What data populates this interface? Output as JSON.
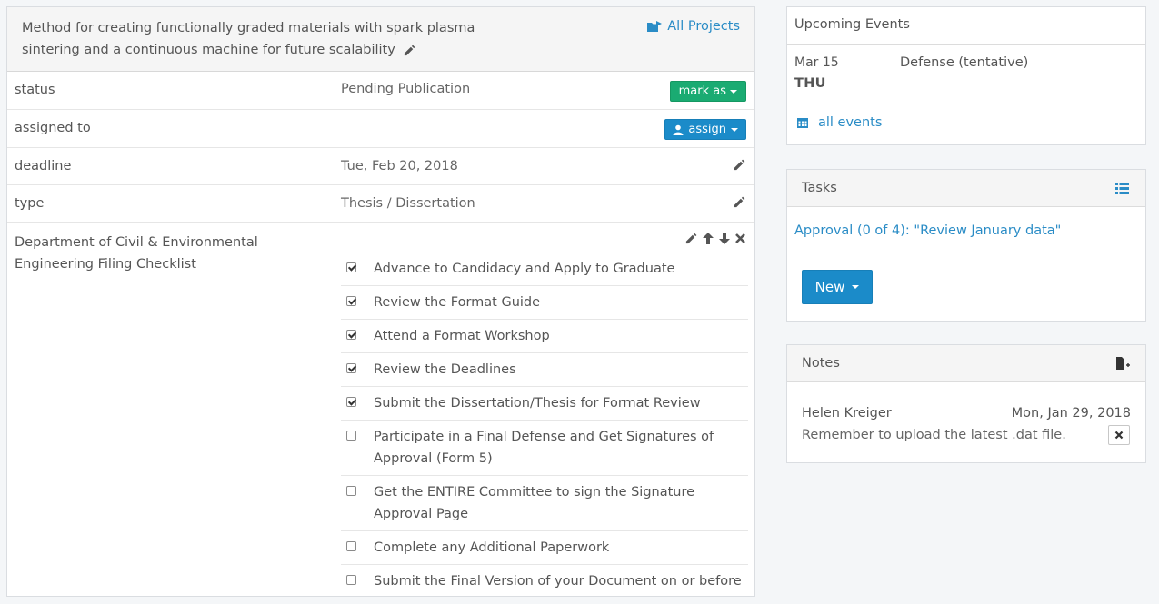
{
  "project": {
    "title": "Method for creating functionally graded materials with spark plasma sintering and a continuous machine for future scalability",
    "all_projects_label": "All Projects"
  },
  "fields": {
    "status_label": "status",
    "status_value": "Pending Publication",
    "mark_as_label": "mark as",
    "assigned_label": "assigned to",
    "assign_label": "assign",
    "deadline_label": "deadline",
    "deadline_value": "Tue, Feb 20, 2018",
    "type_label": "type",
    "type_value": "Thesis / Dissertation"
  },
  "checklist": {
    "name": "Department of Civil & Environmental Engineering Filing Checklist",
    "items": [
      {
        "text": "Advance to Candidacy and Apply to Graduate",
        "checked": true
      },
      {
        "text": "Review the Format Guide",
        "checked": true
      },
      {
        "text": "Attend a Format Workshop",
        "checked": true
      },
      {
        "text": "Review the Deadlines",
        "checked": true
      },
      {
        "text": "Submit the Dissertation/Thesis for Format Review",
        "checked": true
      },
      {
        "text": "Participate in a Final Defense and Get Signatures of Approval (Form 5)",
        "checked": false
      },
      {
        "text": "Get the ENTIRE Committee to sign the Signature Approval Page",
        "checked": false
      },
      {
        "text": "Complete any Additional Paperwork",
        "checked": false
      },
      {
        "text": "Submit the Final Version of your Document on or before",
        "checked": false
      }
    ]
  },
  "events": {
    "title": "Upcoming Events",
    "date": "Mar 15",
    "day": "THU",
    "name": "Defense (tentative)",
    "all_events_label": "all events"
  },
  "tasks": {
    "title": "Tasks",
    "link_text": "Approval (0 of 4): \"Review January data\"",
    "new_label": "New"
  },
  "notes": {
    "title": "Notes",
    "author": "Helen Kreiger",
    "date": "Mon, Jan 29, 2018",
    "body": "Remember to upload the latest .dat file."
  },
  "colors": {
    "link": "#2a8cc6",
    "primary_button": "#1b8bc9",
    "success_button": "#1aab72"
  }
}
